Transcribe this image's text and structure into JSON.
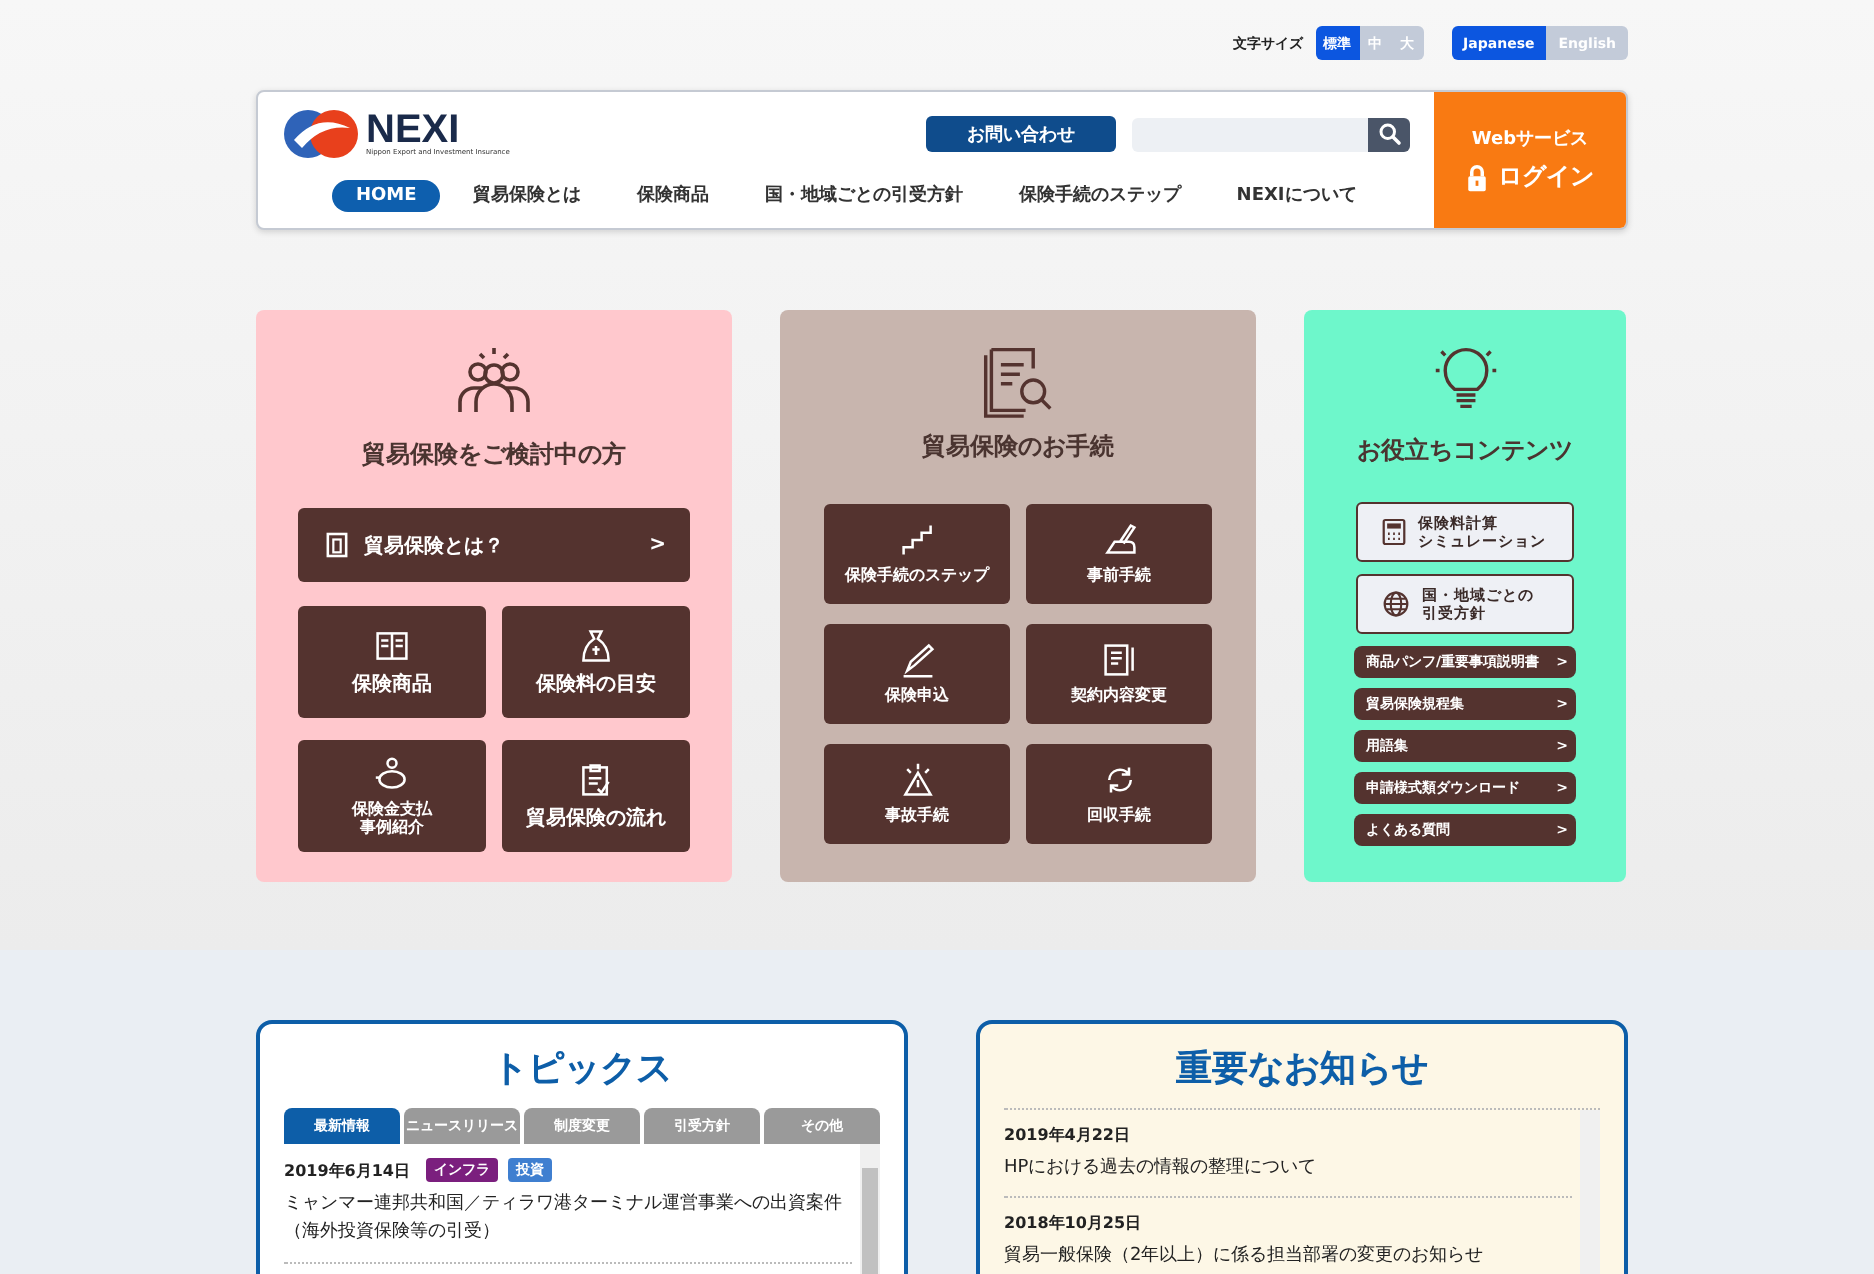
{
  "utility": {
    "font_size_label": "文字サイズ",
    "font_sizes": [
      {
        "label": "標準",
        "selected": true
      },
      {
        "label": "中",
        "selected": false
      },
      {
        "label": "大",
        "selected": false
      }
    ],
    "languages": [
      {
        "label": "Japanese",
        "selected": true
      },
      {
        "label": "English",
        "selected": false
      }
    ]
  },
  "header": {
    "logo": {
      "name": "NEXI",
      "tagline": "Nippon Export and Investment Insurance"
    },
    "contact_button": "お問い合わせ",
    "nav": [
      {
        "label": "HOME",
        "selected": true
      },
      {
        "label": "貿易保険とは",
        "selected": false
      },
      {
        "label": "保険商品",
        "selected": false
      },
      {
        "label": "国・地域ごとの引受方針",
        "selected": false
      },
      {
        "label": "保険手続のステップ",
        "selected": false
      },
      {
        "label": "NEXIについて",
        "selected": false
      }
    ],
    "login": {
      "service": "Webサービス",
      "label": "ログイン"
    }
  },
  "consider": {
    "title": "貿易保険をご検討中の方",
    "featured": "貿易保険とは？",
    "featured_arrow": ">",
    "tiles": [
      {
        "lines": [
          "保険商品"
        ]
      },
      {
        "lines": [
          "保険料の目安"
        ]
      },
      {
        "lines": [
          "保険金支払",
          "事例紹介"
        ]
      },
      {
        "lines": [
          "貿易保険の流れ"
        ]
      }
    ]
  },
  "procedures": {
    "title": "貿易保険のお手続",
    "tiles": [
      "保険手続のステップ",
      "事前手続",
      "保険申込",
      "契約内容変更",
      "事故手続",
      "回収手続"
    ]
  },
  "useful": {
    "title": "お役立ちコンテンツ",
    "big_buttons": [
      {
        "lines": [
          "保険料計算",
          "シミュレーション"
        ]
      },
      {
        "lines": [
          "国・地域ごとの",
          "引受方針"
        ]
      }
    ],
    "links": [
      "商品パンフ/重要事項説明書",
      "貿易保険規程集",
      "用語集",
      "申請様式類ダウンロード",
      "よくある質問"
    ],
    "link_arrow": ">"
  },
  "topics": {
    "title": "トピックス",
    "tabs": [
      {
        "label": "最新情報",
        "selected": true
      },
      {
        "label": "ニュースリリース",
        "selected": false
      },
      {
        "label": "制度変更",
        "selected": false
      },
      {
        "label": "引受方針",
        "selected": false
      },
      {
        "label": "その他",
        "selected": false
      }
    ],
    "items": [
      {
        "date": "2019年6月14日",
        "tags": [
          {
            "label": "インフラ",
            "color": "#7b1f7e"
          },
          {
            "label": "投資",
            "color": "#3f7fd0"
          }
        ],
        "title": "ミャンマー連邦共和国／ティラワ港ターミナル運営事業への出資案件（海外投資保険等の引受）"
      }
    ]
  },
  "notices": {
    "title": "重要なお知らせ",
    "items": [
      {
        "date": "2019年4月22日",
        "title": "HPにおける過去の情報の整理について"
      },
      {
        "date": "2018年10月25日",
        "title": "貿易一般保険（2年以上）に係る担当部署の変更のお知らせ"
      }
    ]
  }
}
